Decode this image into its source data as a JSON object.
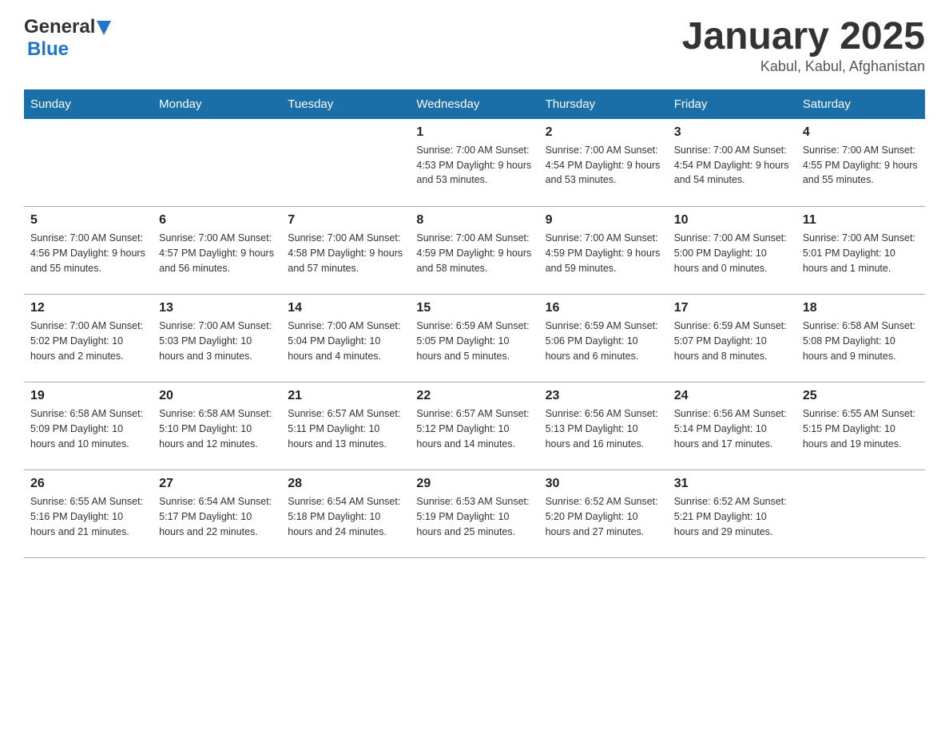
{
  "header": {
    "logo_general": "General",
    "logo_blue": "Blue",
    "title": "January 2025",
    "subtitle": "Kabul, Kabul, Afghanistan"
  },
  "days_of_week": [
    "Sunday",
    "Monday",
    "Tuesday",
    "Wednesday",
    "Thursday",
    "Friday",
    "Saturday"
  ],
  "weeks": [
    [
      {
        "num": "",
        "info": ""
      },
      {
        "num": "",
        "info": ""
      },
      {
        "num": "",
        "info": ""
      },
      {
        "num": "1",
        "info": "Sunrise: 7:00 AM\nSunset: 4:53 PM\nDaylight: 9 hours\nand 53 minutes."
      },
      {
        "num": "2",
        "info": "Sunrise: 7:00 AM\nSunset: 4:54 PM\nDaylight: 9 hours\nand 53 minutes."
      },
      {
        "num": "3",
        "info": "Sunrise: 7:00 AM\nSunset: 4:54 PM\nDaylight: 9 hours\nand 54 minutes."
      },
      {
        "num": "4",
        "info": "Sunrise: 7:00 AM\nSunset: 4:55 PM\nDaylight: 9 hours\nand 55 minutes."
      }
    ],
    [
      {
        "num": "5",
        "info": "Sunrise: 7:00 AM\nSunset: 4:56 PM\nDaylight: 9 hours\nand 55 minutes."
      },
      {
        "num": "6",
        "info": "Sunrise: 7:00 AM\nSunset: 4:57 PM\nDaylight: 9 hours\nand 56 minutes."
      },
      {
        "num": "7",
        "info": "Sunrise: 7:00 AM\nSunset: 4:58 PM\nDaylight: 9 hours\nand 57 minutes."
      },
      {
        "num": "8",
        "info": "Sunrise: 7:00 AM\nSunset: 4:59 PM\nDaylight: 9 hours\nand 58 minutes."
      },
      {
        "num": "9",
        "info": "Sunrise: 7:00 AM\nSunset: 4:59 PM\nDaylight: 9 hours\nand 59 minutes."
      },
      {
        "num": "10",
        "info": "Sunrise: 7:00 AM\nSunset: 5:00 PM\nDaylight: 10 hours\nand 0 minutes."
      },
      {
        "num": "11",
        "info": "Sunrise: 7:00 AM\nSunset: 5:01 PM\nDaylight: 10 hours\nand 1 minute."
      }
    ],
    [
      {
        "num": "12",
        "info": "Sunrise: 7:00 AM\nSunset: 5:02 PM\nDaylight: 10 hours\nand 2 minutes."
      },
      {
        "num": "13",
        "info": "Sunrise: 7:00 AM\nSunset: 5:03 PM\nDaylight: 10 hours\nand 3 minutes."
      },
      {
        "num": "14",
        "info": "Sunrise: 7:00 AM\nSunset: 5:04 PM\nDaylight: 10 hours\nand 4 minutes."
      },
      {
        "num": "15",
        "info": "Sunrise: 6:59 AM\nSunset: 5:05 PM\nDaylight: 10 hours\nand 5 minutes."
      },
      {
        "num": "16",
        "info": "Sunrise: 6:59 AM\nSunset: 5:06 PM\nDaylight: 10 hours\nand 6 minutes."
      },
      {
        "num": "17",
        "info": "Sunrise: 6:59 AM\nSunset: 5:07 PM\nDaylight: 10 hours\nand 8 minutes."
      },
      {
        "num": "18",
        "info": "Sunrise: 6:58 AM\nSunset: 5:08 PM\nDaylight: 10 hours\nand 9 minutes."
      }
    ],
    [
      {
        "num": "19",
        "info": "Sunrise: 6:58 AM\nSunset: 5:09 PM\nDaylight: 10 hours\nand 10 minutes."
      },
      {
        "num": "20",
        "info": "Sunrise: 6:58 AM\nSunset: 5:10 PM\nDaylight: 10 hours\nand 12 minutes."
      },
      {
        "num": "21",
        "info": "Sunrise: 6:57 AM\nSunset: 5:11 PM\nDaylight: 10 hours\nand 13 minutes."
      },
      {
        "num": "22",
        "info": "Sunrise: 6:57 AM\nSunset: 5:12 PM\nDaylight: 10 hours\nand 14 minutes."
      },
      {
        "num": "23",
        "info": "Sunrise: 6:56 AM\nSunset: 5:13 PM\nDaylight: 10 hours\nand 16 minutes."
      },
      {
        "num": "24",
        "info": "Sunrise: 6:56 AM\nSunset: 5:14 PM\nDaylight: 10 hours\nand 17 minutes."
      },
      {
        "num": "25",
        "info": "Sunrise: 6:55 AM\nSunset: 5:15 PM\nDaylight: 10 hours\nand 19 minutes."
      }
    ],
    [
      {
        "num": "26",
        "info": "Sunrise: 6:55 AM\nSunset: 5:16 PM\nDaylight: 10 hours\nand 21 minutes."
      },
      {
        "num": "27",
        "info": "Sunrise: 6:54 AM\nSunset: 5:17 PM\nDaylight: 10 hours\nand 22 minutes."
      },
      {
        "num": "28",
        "info": "Sunrise: 6:54 AM\nSunset: 5:18 PM\nDaylight: 10 hours\nand 24 minutes."
      },
      {
        "num": "29",
        "info": "Sunrise: 6:53 AM\nSunset: 5:19 PM\nDaylight: 10 hours\nand 25 minutes."
      },
      {
        "num": "30",
        "info": "Sunrise: 6:52 AM\nSunset: 5:20 PM\nDaylight: 10 hours\nand 27 minutes."
      },
      {
        "num": "31",
        "info": "Sunrise: 6:52 AM\nSunset: 5:21 PM\nDaylight: 10 hours\nand 29 minutes."
      },
      {
        "num": "",
        "info": ""
      }
    ]
  ]
}
